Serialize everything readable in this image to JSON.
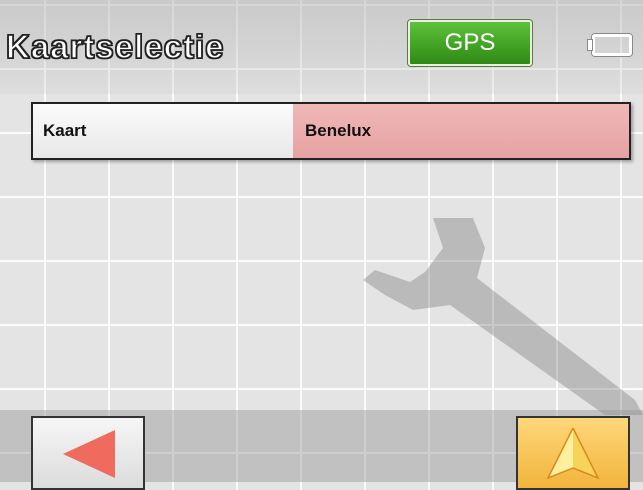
{
  "header": {
    "title": "Kaartselectie",
    "gps_label": "GPS",
    "battery_icon": "battery-icon"
  },
  "settings": [
    {
      "label": "Kaart",
      "value": "Benelux"
    }
  ],
  "footer": {
    "back_icon": "back-arrow-icon",
    "navigate_icon": "navigation-arrow-icon"
  },
  "colors": {
    "gps_background": "#3aa01c",
    "value_background": "#eaa9a9",
    "navigate_button": "#f5bb45",
    "back_arrow": "#ee6b5e"
  }
}
